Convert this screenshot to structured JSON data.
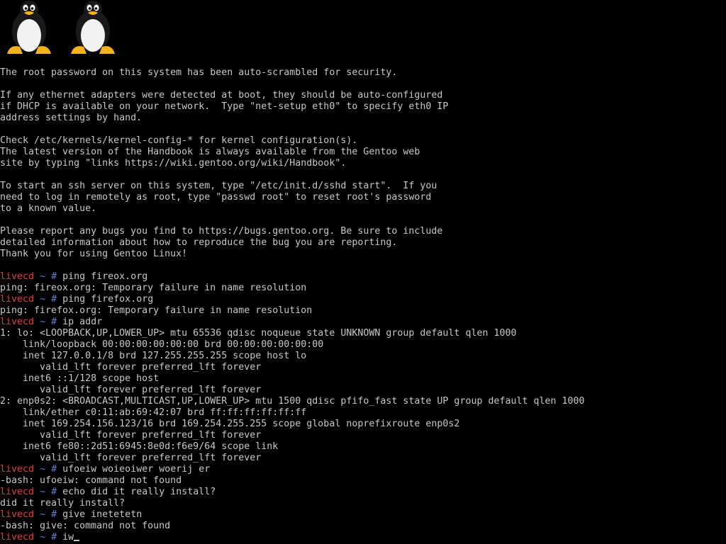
{
  "motd": [
    "The root password on this system has been auto-scrambled for security.",
    "",
    "If any ethernet adapters were detected at boot, they should be auto-configured",
    "if DHCP is available on your network.  Type \"net-setup eth0\" to specify eth0 IP",
    "address settings by hand.",
    "",
    "Check /etc/kernels/kernel-config-* for kernel configuration(s).",
    "The latest version of the Handbook is always available from the Gentoo web",
    "site by typing \"links https://wiki.gentoo.org/wiki/Handbook\".",
    "",
    "To start an ssh server on this system, type \"/etc/init.d/sshd start\".  If you",
    "need to log in remotely as root, type \"passwd root\" to reset root's password",
    "to a known value.",
    "",
    "Please report any bugs you find to https://bugs.gentoo.org. Be sure to include",
    "detailed information about how to reproduce the bug you are reporting.",
    "Thank you for using Gentoo Linux!",
    ""
  ],
  "prompt": {
    "host": "livecd",
    "tilde": "~",
    "hash": "#"
  },
  "session": [
    {
      "type": "cmd",
      "text": "ping fireox.org"
    },
    {
      "type": "out",
      "text": "ping: fireox.org: Temporary failure in name resolution"
    },
    {
      "type": "cmd",
      "text": "ping firefox.org"
    },
    {
      "type": "out",
      "text": "ping: firefox.org: Temporary failure in name resolution"
    },
    {
      "type": "cmd",
      "text": "ip addr"
    },
    {
      "type": "out",
      "text": "1: lo: <LOOPBACK,UP,LOWER_UP> mtu 65536 qdisc noqueue state UNKNOWN group default qlen 1000"
    },
    {
      "type": "out",
      "text": "    link/loopback 00:00:00:00:00:00 brd 00:00:00:00:00:00"
    },
    {
      "type": "out",
      "text": "    inet 127.0.0.1/8 brd 127.255.255.255 scope host lo"
    },
    {
      "type": "out",
      "text": "       valid_lft forever preferred_lft forever"
    },
    {
      "type": "out",
      "text": "    inet6 ::1/128 scope host"
    },
    {
      "type": "out",
      "text": "       valid_lft forever preferred_lft forever"
    },
    {
      "type": "out",
      "text": "2: enp0s2: <BROADCAST,MULTICAST,UP,LOWER_UP> mtu 1500 qdisc pfifo_fast state UP group default qlen 1000"
    },
    {
      "type": "out",
      "text": "    link/ether c0:11:ab:69:42:07 brd ff:ff:ff:ff:ff:ff"
    },
    {
      "type": "out",
      "text": "    inet 169.254.156.123/16 brd 169.254.255.255 scope global noprefixroute enp0s2"
    },
    {
      "type": "out",
      "text": "       valid_lft forever preferred_lft forever"
    },
    {
      "type": "out",
      "text": "    inet6 fe80::2d51:6945:8e0d:f6e9/64 scope link"
    },
    {
      "type": "out",
      "text": "       valid_lft forever preferred_lft forever"
    },
    {
      "type": "cmd",
      "text": "ufoeiw woieoiwer woerij er"
    },
    {
      "type": "out",
      "text": "-bash: ufoeiw: command not found"
    },
    {
      "type": "cmd",
      "text": "echo did it really install?"
    },
    {
      "type": "out",
      "text": "did it really install?"
    },
    {
      "type": "cmd",
      "text": "give inetetetn"
    },
    {
      "type": "out",
      "text": "-bash: give: command not found"
    },
    {
      "type": "cmd",
      "text": "iw",
      "current": true
    }
  ],
  "logo": {
    "icon": "tux-penguin-icon",
    "count": 2
  },
  "colors": {
    "background": "#000000",
    "text": "#c8c8c8",
    "host": "#e04040",
    "tilde": "#5a7fd6"
  }
}
